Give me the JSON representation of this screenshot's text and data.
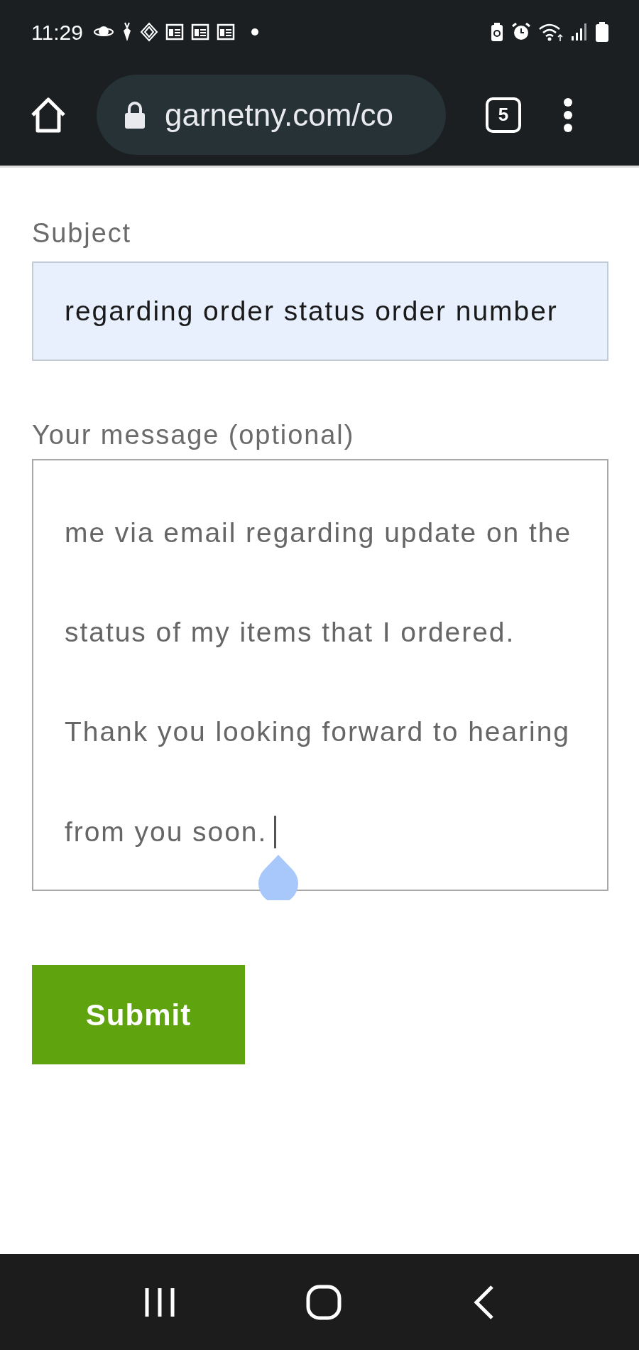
{
  "status_bar": {
    "time": "11:29"
  },
  "browser": {
    "url": "garnetny.com/co",
    "tab_count": "5"
  },
  "form": {
    "subject": {
      "label": "Subject",
      "value": "regarding order status order number"
    },
    "message": {
      "label": "Your message (optional)",
      "value_lines": [
        "me via email regarding update on the",
        "status of my items that I ordered.",
        "Thank you looking forward to hearing",
        "from you soon."
      ]
    },
    "submit": "Submit"
  }
}
